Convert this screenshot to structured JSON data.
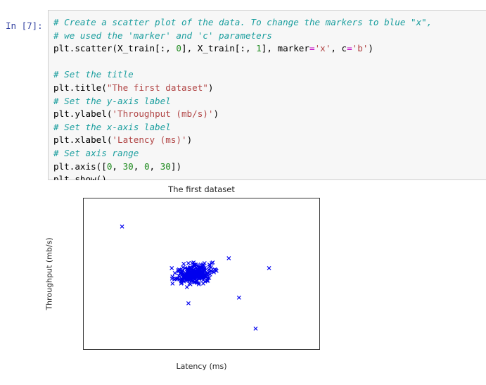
{
  "cell": {
    "prompt": "In [7]:",
    "lines": [
      [
        {
          "t": "# Create a scatter plot of the data. To change the markers to blue \"x\",",
          "c": "cm"
        }
      ],
      [
        {
          "t": "# we used the 'marker' and 'c' parameters",
          "c": "cm"
        }
      ],
      [
        {
          "t": "plt.scatter(X_train[:, ",
          "c": ""
        },
        {
          "t": "0",
          "c": "nu"
        },
        {
          "t": "], X_train[:, ",
          "c": ""
        },
        {
          "t": "1",
          "c": "nu"
        },
        {
          "t": "], marker",
          "c": ""
        },
        {
          "t": "=",
          "c": "op"
        },
        {
          "t": "'x'",
          "c": "st"
        },
        {
          "t": ", c",
          "c": ""
        },
        {
          "t": "=",
          "c": "op"
        },
        {
          "t": "'b'",
          "c": "st"
        },
        {
          "t": ")",
          "c": ""
        }
      ],
      [],
      [
        {
          "t": "# Set the title",
          "c": "cm"
        }
      ],
      [
        {
          "t": "plt.title(",
          "c": ""
        },
        {
          "t": "\"The first dataset\"",
          "c": "st"
        },
        {
          "t": ")",
          "c": ""
        }
      ],
      [
        {
          "t": "# Set the y-axis label",
          "c": "cm"
        }
      ],
      [
        {
          "t": "plt.ylabel(",
          "c": ""
        },
        {
          "t": "'Throughput (mb/s)'",
          "c": "st"
        },
        {
          "t": ")",
          "c": ""
        }
      ],
      [
        {
          "t": "# Set the x-axis label",
          "c": "cm"
        }
      ],
      [
        {
          "t": "plt.xlabel(",
          "c": ""
        },
        {
          "t": "'Latency (ms)'",
          "c": "st"
        },
        {
          "t": ")",
          "c": ""
        }
      ],
      [
        {
          "t": "# Set axis range",
          "c": "cm"
        }
      ],
      [
        {
          "t": "plt.axis([",
          "c": ""
        },
        {
          "t": "0",
          "c": "nu"
        },
        {
          "t": ", ",
          "c": ""
        },
        {
          "t": "30",
          "c": "nu"
        },
        {
          "t": ", ",
          "c": ""
        },
        {
          "t": "0",
          "c": "nu"
        },
        {
          "t": ", ",
          "c": ""
        },
        {
          "t": "30",
          "c": "nu"
        },
        {
          "t": "])",
          "c": ""
        }
      ],
      [
        {
          "t": "plt.show()",
          "c": ""
        }
      ]
    ],
    "colors": {
      "prompt": "#303F9F",
      "background": "#f7f7f7",
      "border": "#cfcfcf",
      "comment": "#1a9e9e",
      "string": "#b14545",
      "number": "#1d8a1d",
      "operator": "#c000c0",
      "text": "#000000"
    }
  },
  "chart_data": {
    "type": "scatter",
    "title": "The first dataset",
    "xlabel": "Latency (ms)",
    "ylabel": "Throughput (mb/s)",
    "xlim": [
      0,
      30
    ],
    "ylim": [
      0,
      30
    ],
    "xticks": [
      0,
      5,
      10,
      15,
      20,
      25,
      30
    ],
    "yticks": [
      0,
      5,
      10,
      15,
      20,
      25,
      30
    ],
    "grid": false,
    "legend": null,
    "series": [
      {
        "name": "X_train",
        "marker": "x",
        "color": "#0000ee",
        "description": "Dense gaussian cluster centred near (14.0, 15.0) plus six isolated outliers",
        "outliers": [
          [
            4.8,
            24.4
          ],
          [
            18.3,
            18.1
          ],
          [
            23.4,
            16.2
          ],
          [
            13.2,
            9.3
          ],
          [
            19.6,
            10.4
          ],
          [
            21.7,
            4.2
          ]
        ],
        "cluster": {
          "center": [
            14.05,
            15.0
          ],
          "n_points": 320,
          "x_std": 1.15,
          "y_std": 0.95,
          "corr": 0.35,
          "x_range": [
            10.7,
            16.8
          ],
          "y_range": [
            12.0,
            17.9
          ]
        }
      }
    ]
  }
}
